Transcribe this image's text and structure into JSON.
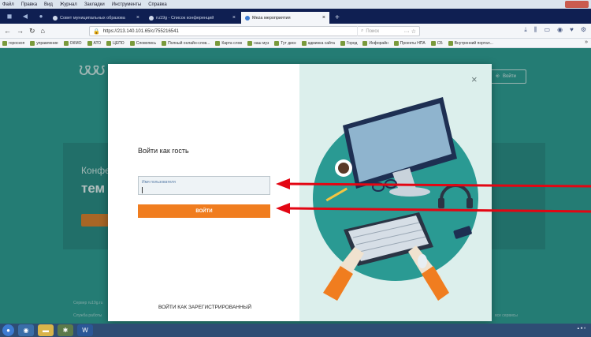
{
  "menubar": {
    "items": [
      "Файл",
      "Правка",
      "Вид",
      "Журнал",
      "Закладки",
      "Инструменты",
      "Справка"
    ]
  },
  "tabs": [
    {
      "label": "Совет муниципальных образова",
      "active": false
    },
    {
      "label": "ru19g - Список конференций",
      "active": false
    },
    {
      "label": "Meza мероприятия",
      "active": true
    }
  ],
  "navbar": {
    "url": "https://213.140.101.65/c/755216541",
    "search_placeholder": "Поиск"
  },
  "bookmarks": [
    "гороскоп",
    "управление",
    "ОКМО",
    "АТО",
    "ЦЕПО",
    "Словопись",
    "Полный онлайн-слов...",
    "Карта слов",
    "наш муз",
    "Тут диск",
    "админка сайта",
    "Город",
    "Инфорайн",
    "Проекты НПА",
    "СБ",
    "Внутренний портал..."
  ],
  "page": {
    "login_label": "Войти",
    "banner_title": "Конфе",
    "banner_sub": "тем",
    "footer_line1": "Сервер ru19g.ru",
    "footer_line2": "Служба работы",
    "footer_right": "все сервисы"
  },
  "modal": {
    "title": "Войти как гость",
    "username_placeholder": "Имя пользователя",
    "submit_label": "ВОЙТИ",
    "register_label": "ВОЙТИ КАК ЗАРЕГИСТРИРОВАННЫЙ"
  },
  "colors": {
    "accent": "#f07d1f",
    "teal": "#2f9c93",
    "arrow": "#e30613"
  }
}
